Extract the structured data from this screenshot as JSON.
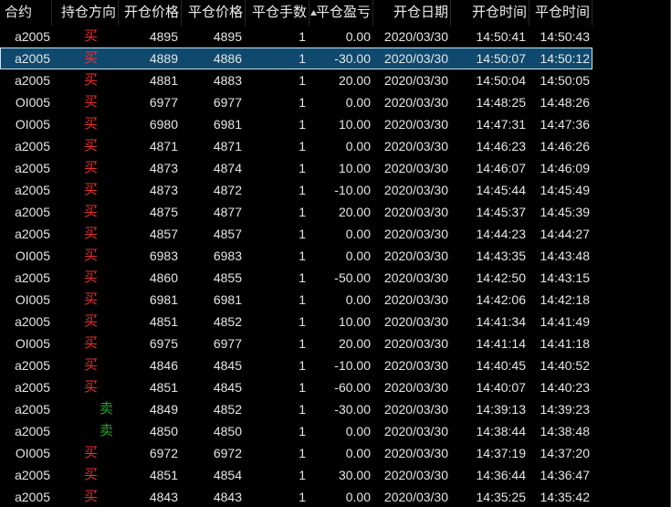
{
  "table": {
    "columns": {
      "contract": "合约",
      "side": "持仓方向",
      "open_price": "开仓价格",
      "close_price": "平仓价格",
      "qty": "平仓手数",
      "pnl": "平仓盈亏",
      "open_date": "开仓日期",
      "open_time": "开仓时间",
      "close_time": "平仓时间"
    },
    "sort_icon": "sort-ascending-icon",
    "selected_row": 1,
    "rows": [
      {
        "contract": "a2005",
        "side": "买",
        "open_price": "4895",
        "close_price": "4895",
        "qty": "1",
        "pnl": "0.00",
        "open_date": "2020/03/30",
        "open_time": "14:50:41",
        "close_time": "14:50:43"
      },
      {
        "contract": "a2005",
        "side": "买",
        "open_price": "4889",
        "close_price": "4886",
        "qty": "1",
        "pnl": "-30.00",
        "open_date": "2020/03/30",
        "open_time": "14:50:07",
        "close_time": "14:50:12"
      },
      {
        "contract": "a2005",
        "side": "买",
        "open_price": "4881",
        "close_price": "4883",
        "qty": "1",
        "pnl": "20.00",
        "open_date": "2020/03/30",
        "open_time": "14:50:04",
        "close_time": "14:50:05"
      },
      {
        "contract": "OI005",
        "side": "买",
        "open_price": "6977",
        "close_price": "6977",
        "qty": "1",
        "pnl": "0.00",
        "open_date": "2020/03/30",
        "open_time": "14:48:25",
        "close_time": "14:48:26"
      },
      {
        "contract": "OI005",
        "side": "买",
        "open_price": "6980",
        "close_price": "6981",
        "qty": "1",
        "pnl": "10.00",
        "open_date": "2020/03/30",
        "open_time": "14:47:31",
        "close_time": "14:47:36"
      },
      {
        "contract": "a2005",
        "side": "买",
        "open_price": "4871",
        "close_price": "4871",
        "qty": "1",
        "pnl": "0.00",
        "open_date": "2020/03/30",
        "open_time": "14:46:23",
        "close_time": "14:46:26"
      },
      {
        "contract": "a2005",
        "side": "买",
        "open_price": "4873",
        "close_price": "4874",
        "qty": "1",
        "pnl": "10.00",
        "open_date": "2020/03/30",
        "open_time": "14:46:07",
        "close_time": "14:46:09"
      },
      {
        "contract": "a2005",
        "side": "买",
        "open_price": "4873",
        "close_price": "4872",
        "qty": "1",
        "pnl": "-10.00",
        "open_date": "2020/03/30",
        "open_time": "14:45:44",
        "close_time": "14:45:49"
      },
      {
        "contract": "a2005",
        "side": "买",
        "open_price": "4875",
        "close_price": "4877",
        "qty": "1",
        "pnl": "20.00",
        "open_date": "2020/03/30",
        "open_time": "14:45:37",
        "close_time": "14:45:39"
      },
      {
        "contract": "a2005",
        "side": "买",
        "open_price": "4857",
        "close_price": "4857",
        "qty": "1",
        "pnl": "0.00",
        "open_date": "2020/03/30",
        "open_time": "14:44:23",
        "close_time": "14:44:27"
      },
      {
        "contract": "OI005",
        "side": "买",
        "open_price": "6983",
        "close_price": "6983",
        "qty": "1",
        "pnl": "0.00",
        "open_date": "2020/03/30",
        "open_time": "14:43:35",
        "close_time": "14:43:48"
      },
      {
        "contract": "a2005",
        "side": "买",
        "open_price": "4860",
        "close_price": "4855",
        "qty": "1",
        "pnl": "-50.00",
        "open_date": "2020/03/30",
        "open_time": "14:42:50",
        "close_time": "14:43:15"
      },
      {
        "contract": "OI005",
        "side": "买",
        "open_price": "6981",
        "close_price": "6981",
        "qty": "1",
        "pnl": "0.00",
        "open_date": "2020/03/30",
        "open_time": "14:42:06",
        "close_time": "14:42:18"
      },
      {
        "contract": "a2005",
        "side": "买",
        "open_price": "4851",
        "close_price": "4852",
        "qty": "1",
        "pnl": "10.00",
        "open_date": "2020/03/30",
        "open_time": "14:41:34",
        "close_time": "14:41:49"
      },
      {
        "contract": "OI005",
        "side": "买",
        "open_price": "6975",
        "close_price": "6977",
        "qty": "1",
        "pnl": "20.00",
        "open_date": "2020/03/30",
        "open_time": "14:41:14",
        "close_time": "14:41:18"
      },
      {
        "contract": "a2005",
        "side": "买",
        "open_price": "4846",
        "close_price": "4845",
        "qty": "1",
        "pnl": "-10.00",
        "open_date": "2020/03/30",
        "open_time": "14:40:45",
        "close_time": "14:40:52"
      },
      {
        "contract": "a2005",
        "side": "买",
        "open_price": "4851",
        "close_price": "4845",
        "qty": "1",
        "pnl": "-60.00",
        "open_date": "2020/03/30",
        "open_time": "14:40:07",
        "close_time": "14:40:23"
      },
      {
        "contract": "a2005",
        "side": "卖",
        "open_price": "4849",
        "close_price": "4852",
        "qty": "1",
        "pnl": "-30.00",
        "open_date": "2020/03/30",
        "open_time": "14:39:13",
        "close_time": "14:39:23"
      },
      {
        "contract": "a2005",
        "side": "卖",
        "open_price": "4850",
        "close_price": "4850",
        "qty": "1",
        "pnl": "0.00",
        "open_date": "2020/03/30",
        "open_time": "14:38:44",
        "close_time": "14:38:48"
      },
      {
        "contract": "OI005",
        "side": "买",
        "open_price": "6972",
        "close_price": "6972",
        "qty": "1",
        "pnl": "0.00",
        "open_date": "2020/03/30",
        "open_time": "14:37:19",
        "close_time": "14:37:20"
      },
      {
        "contract": "a2005",
        "side": "买",
        "open_price": "4851",
        "close_price": "4854",
        "qty": "1",
        "pnl": "30.00",
        "open_date": "2020/03/30",
        "open_time": "14:36:44",
        "close_time": "14:36:47"
      },
      {
        "contract": "a2005",
        "side": "买",
        "open_price": "4843",
        "close_price": "4843",
        "qty": "1",
        "pnl": "0.00",
        "open_date": "2020/03/30",
        "open_time": "14:35:25",
        "close_time": "14:35:42"
      }
    ]
  },
  "colors": {
    "background": "#000000",
    "header_text": "#ececec",
    "text": "#e6e6e6",
    "selected_bg": "#0f4a6e",
    "selected_border": "#d0e2ee",
    "sort_icon": "#cfcfcf",
    "side": {
      "买": "#e8312f",
      "卖": "#27a32a"
    }
  }
}
